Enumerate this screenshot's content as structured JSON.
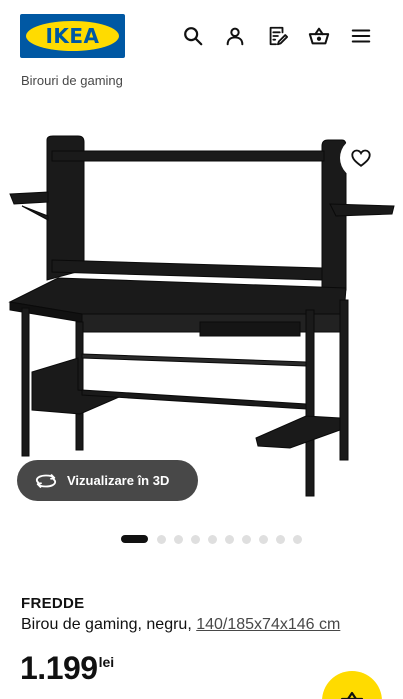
{
  "header": {
    "logo_text": "IKEA",
    "icons": [
      "search-icon",
      "user-icon",
      "shopping-list-icon",
      "basket-icon",
      "menu-icon"
    ]
  },
  "breadcrumb": "Birouri de gaming",
  "gallery": {
    "view_3d_label": "Vizualizare în 3D",
    "image_count": 10,
    "active_index": 1
  },
  "product": {
    "name": "FREDDE",
    "description": "Birou de gaming, negru, ",
    "dimensions": "140/185x74x146 cm",
    "price_value": "1.199",
    "price_currency": "lei"
  },
  "colors": {
    "brand_blue": "#0058a3",
    "brand_yellow": "#ffdb00",
    "button_dark": "#484848"
  }
}
